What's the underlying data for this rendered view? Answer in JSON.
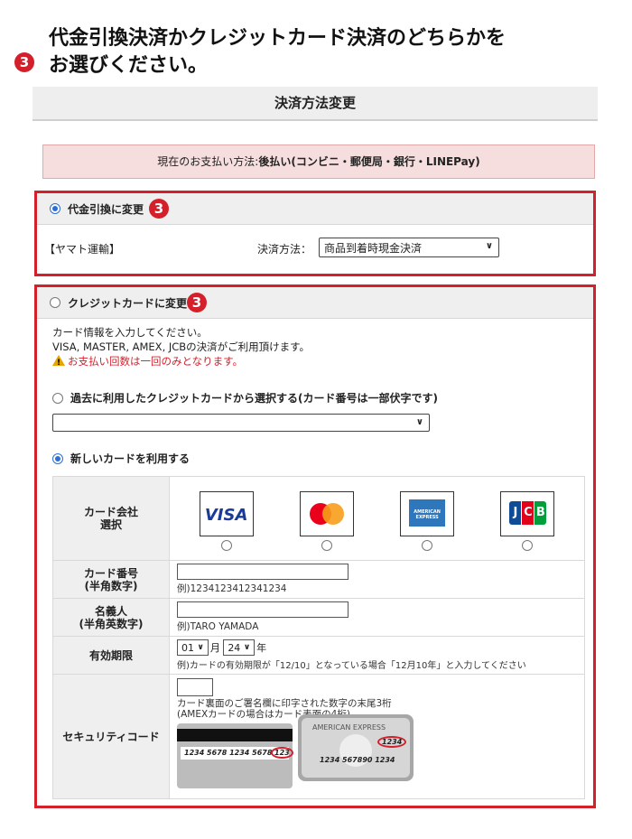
{
  "heading": {
    "badge": "3",
    "text_line1": "代金引換決済かクレジットカード決済のどちらかを",
    "text_line2": "お選びください。"
  },
  "title_bar": "決済方法変更",
  "current_payment": {
    "label": "現在のお支払い方法:",
    "value": "後払い(コンビニ・郵便局・銀行・LINEPay)"
  },
  "cod": {
    "radio_label": "代金引換に変更",
    "badge": "3",
    "selected": true,
    "carrier": "【ヤマト運輸】",
    "method_label": "決済方法：",
    "method_value": "商品到着時現金決済"
  },
  "credit": {
    "radio_label": "クレジットカードに変更",
    "badge": "3",
    "selected": false,
    "desc1": "カード情報を入力してください。",
    "desc2": "VISA, MASTER, AMEX, JCBの決済がご利用頂けます。",
    "warning": "お支払い回数は一回のみとなります。",
    "past_card_label": "過去に利用したクレジットカードから選択する(カード番号は一部伏字です)",
    "past_card_value": "",
    "new_card_label": "新しいカードを利用する",
    "new_card_selected": true,
    "card_company_label": "カード会社\n選択",
    "brands": [
      "VISA",
      "MASTER",
      "AMEX",
      "JCB"
    ],
    "card_number_label": "カード番号\n(半角数字)",
    "card_number_hint": "例)1234123412341234",
    "holder_label": "名義人\n(半角英数字)",
    "holder_hint": "例)TARO YAMADA",
    "expiry_label": "有効期限",
    "expiry_month": "01",
    "month_unit": "月",
    "expiry_year": "24",
    "year_unit": "年",
    "expiry_hint": "例)カードの有効期限が「12/10」となっている場合「12月10年」と入力してください",
    "security_label": "セキュリティコード",
    "security_hint1": "カード裏面のご署名欄に印字された数字の末尾3桁",
    "security_hint2": "(AMEXカードの場合はカード表面の4桁)",
    "back_card_number": "1234 5678 1234 5678",
    "back_card_code": "123",
    "amex_title": "AMERICAN EXPRESS",
    "amex_code": "1234",
    "amex_number": "1234 567890 1234"
  },
  "colors": {
    "accent_red": "#d4202a",
    "radio_blue": "#2b6fd6",
    "pink_bg": "#f6dede"
  }
}
